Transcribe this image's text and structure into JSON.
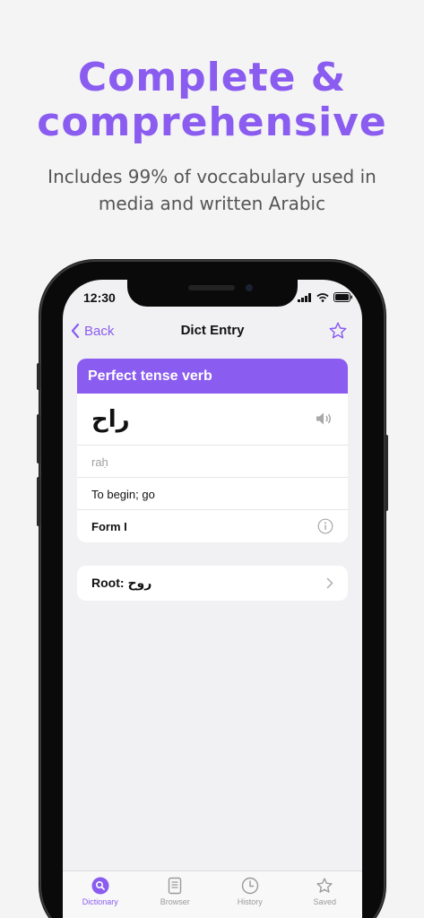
{
  "promo": {
    "headline_line1": "Complete &",
    "headline_line2": "comprehensive",
    "subline_line1": "Includes 99% of voccabulary used in",
    "subline_line2": "media and written Arabic"
  },
  "status_bar": {
    "time": "12:30"
  },
  "nav": {
    "back_label": "Back",
    "title": "Dict Entry",
    "star_icon": "star-outline-icon"
  },
  "entry": {
    "header": "Perfect tense verb",
    "arabic": "راح",
    "transliteration": "raḥ",
    "meaning": "To begin; go",
    "form": "Form I"
  },
  "root": {
    "prefix": "Root:",
    "arabic": "روح"
  },
  "tabs": [
    {
      "label": "Dictionary",
      "icon": "search-icon",
      "active": true
    },
    {
      "label": "Browser",
      "icon": "book-icon",
      "active": false
    },
    {
      "label": "History",
      "icon": "clock-icon",
      "active": false
    },
    {
      "label": "Saved",
      "icon": "star-icon",
      "active": false
    }
  ],
  "colors": {
    "accent": "#8a5cf0",
    "background": "#f4f4f4"
  }
}
